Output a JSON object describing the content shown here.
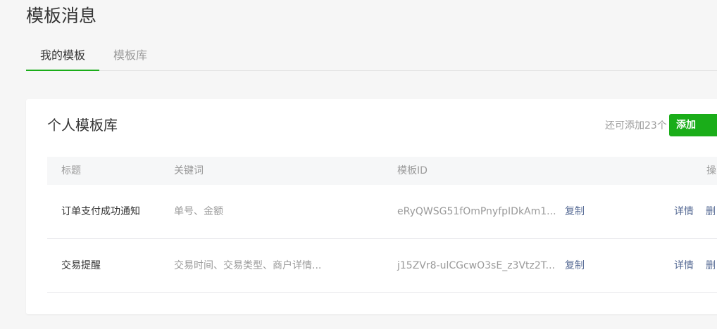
{
  "page": {
    "title": "模板消息"
  },
  "tabs": [
    {
      "label": "我的模板",
      "active": true
    },
    {
      "label": "模板库",
      "active": false
    }
  ],
  "card": {
    "title": "个人模板库",
    "quota_text": "还可添加23个",
    "add_label": "添加"
  },
  "table": {
    "headers": {
      "title": "标题",
      "keywords": "关键词",
      "template_id": "模板ID",
      "ops": "操"
    },
    "rows": [
      {
        "title": "订单支付成功通知",
        "keywords": "单号、金额",
        "template_id": "eRyQWSG51fOmPnyfpIDkAm1...",
        "copy": "复制",
        "detail": "详情",
        "delete": "删"
      },
      {
        "title": "交易提醒",
        "keywords": "交易时间、交易类型、商户详情...",
        "template_id": "j15ZVr8-ulCGcwO3sE_z3Vtz2T...",
        "copy": "复制",
        "detail": "详情",
        "delete": "删"
      }
    ]
  },
  "colors": {
    "accent": "#1aad19",
    "link": "#576b95",
    "muted": "#9a9a9a",
    "text": "#353535"
  }
}
